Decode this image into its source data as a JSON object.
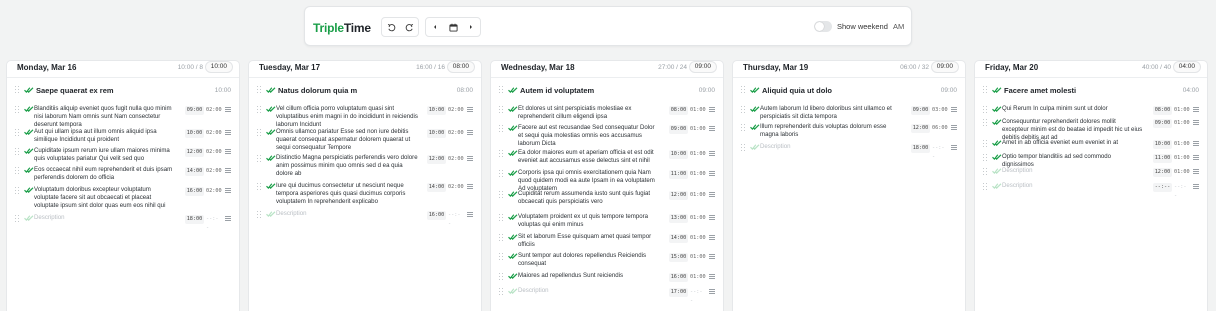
{
  "app": {
    "logo_part1": "Triple",
    "logo_part2": "Time",
    "show_weekend_label": "Show weekend",
    "ampm_label": "AM"
  },
  "colors": {
    "accent": "#1a9e48",
    "text": "#1f2328",
    "muted": "#9aa0a6"
  },
  "icons": {
    "undo": "undo-icon",
    "redo": "redo-icon",
    "prev": "chevron-left-icon",
    "calendar": "calendar-icon",
    "next": "chevron-right-icon"
  },
  "days": [
    {
      "label": "Monday, Mar 16",
      "ratio": "10:00 / 8",
      "time": "10:00",
      "topic": {
        "title": "Saepe quaerat ex rem",
        "time": "10:00"
      },
      "tasks": [
        {
          "title": "Blanditiis aliquip eveniet quos fugit nulla quo minim nisi laborum Nam omnis sunt Nam consectetur deserunt tempora",
          "start": "09:00",
          "dur": "02:00"
        },
        {
          "title": "Aut qui ullam ipsa aut illum omnis aliquid ipsa similique Incididunt qui proident",
          "start": "10:00",
          "dur": "02:00"
        },
        {
          "title": "Cupiditate ipsum rerum iure ullam maiores minima quis voluptates pariatur Qui velit sed quo",
          "start": "12:00",
          "dur": "02:00"
        },
        {
          "title": "Eos occaecat nihil eum reprehenderit et duis ipsam perferendis dolorem do officia",
          "start": "14:00",
          "dur": "02:00"
        },
        {
          "title": "Voluptatum doloribus excepteur voluptatum voluptate facere sit aut obcaecati et placeat voluptate ipsum sint dolor quas eum eos nihil qui",
          "start": "16:00",
          "dur": "02:00"
        },
        {
          "title": "Description",
          "start": "18:00",
          "dur": "--:--",
          "placeholder": true
        }
      ]
    },
    {
      "label": "Tuesday, Mar 17",
      "ratio": "16:00 / 16",
      "time": "08:00",
      "topic": {
        "title": "Natus dolorum quia m",
        "time": "08:00"
      },
      "tasks": [
        {
          "title": "Vel cillum officia porro voluptatum quasi sint voluptatibus enim magni in do incididunt in reiciendis laborum Incidunt",
          "start": "10:00",
          "dur": "02:00"
        },
        {
          "title": "Omnis ullamco pariatur Esse sed non iure debitis quaerat consequat aspernatur dolorem quaerat ut sequi consequatur Tempore",
          "start": "10:00",
          "dur": "02:00"
        },
        {
          "title": "Distinctio Magna perspiciatis perferendis vero dolore anim possimus minim quo omnis sed d ea quia dolore ab",
          "start": "12:00",
          "dur": "02:00"
        },
        {
          "title": "Iure qui ducimus consectetur ut nesciunt neque tempora asperiores quis quasi ducimus corporis voluptatem In reprehenderit explicabo",
          "start": "14:00",
          "dur": "02:00"
        },
        {
          "title": "Description",
          "start": "16:00",
          "dur": "--:--",
          "placeholder": true
        }
      ]
    },
    {
      "label": "Wednesday, Mar 18",
      "ratio": "27:00 / 24",
      "time": "09:00",
      "topic": {
        "title": "Autem id voluptatem",
        "time": "09:00"
      },
      "tasks": [
        {
          "title": "Et dolores ut sint perspiciatis molestiae ex reprehenderit cillum eligendi ipsa",
          "start": "08:00",
          "dur": "01:00"
        },
        {
          "title": "Facere aut est recusandae Sed consequatur Dolor et sequi quia molestias omnis eos accusamus laborum Dicta",
          "start": "09:00",
          "dur": "01:00"
        },
        {
          "title": "Ea dolor maiores eum et aperiam officia et est odit eveniet aut accusamus esse delectus sint et nihil",
          "start": "10:00",
          "dur": "01:00"
        },
        {
          "title": "Corporis ipsa qui omnis exercitationem quia Nam quod quidem modi ea aute Ipsam in ea voluptatem Ad voluptatem",
          "start": "11:00",
          "dur": "01:00"
        },
        {
          "title": "Cupiditat rerum assumenda iusto sunt quis fugiat obcaecati quis perspiciatis vero",
          "start": "12:00",
          "dur": "01:00"
        },
        {
          "title": "Voluptatem proident ex ut quis tempore tempora voluptas qui enim minus",
          "start": "13:00",
          "dur": "01:00"
        },
        {
          "title": "Sit et laborum Esse quisquam amet quasi tempor officiis",
          "start": "14:00",
          "dur": "01:00"
        },
        {
          "title": "Sunt tempor aut dolores repellendus Reiciendis consequat",
          "start": "15:00",
          "dur": "01:00"
        },
        {
          "title": "Maiores ad repellendus Sunt reiciendis",
          "start": "16:00",
          "dur": "01:00"
        },
        {
          "title": "Description",
          "start": "17:00",
          "dur": "--:--",
          "placeholder": true
        }
      ]
    },
    {
      "label": "Thursday, Mar 19",
      "ratio": "06:00 / 32",
      "time": "09:00",
      "topic": {
        "title": "Aliquid quia ut dolo",
        "time": "09:00"
      },
      "tasks": [
        {
          "title": "Autem laborum Id libero doloribus sint ullamco et perspiciatis sit dicta tempora",
          "start": "09:00",
          "dur": "03:00"
        },
        {
          "title": "Illum reprehenderit duis voluptas dolorum esse magna laboris",
          "start": "12:00",
          "dur": "06:00"
        },
        {
          "title": "Description",
          "start": "18:00",
          "dur": "--:--",
          "placeholder": true
        }
      ]
    },
    {
      "label": "Friday, Mar 20",
      "ratio": "40:00 / 40",
      "time": "04:00",
      "topic": {
        "title": "Facere amet molesti",
        "time": "04:00"
      },
      "tasks": [
        {
          "title": "Qui Rerum In culpa minim sunt ut dolor",
          "start": "08:00",
          "dur": "01:00"
        },
        {
          "title": "Consequuntur reprehenderit dolores mollit excepteur minim est do beatae id impedit hic ut eius debitis debitis aut ad",
          "start": "09:00",
          "dur": "01:00"
        },
        {
          "title": "Amet in ab officia eveniet eum eveniet in at",
          "start": "10:00",
          "dur": "01:00"
        },
        {
          "title": "Optio tempor blanditiis ad sed commodo dignissimos",
          "start": "11:00",
          "dur": "01:00"
        },
        {
          "title": "Description",
          "start": "12:00",
          "dur": "01:00",
          "placeholder": true
        },
        {
          "title": "Description",
          "start": "--:--",
          "dur": "--:--",
          "placeholder": true
        }
      ]
    }
  ]
}
